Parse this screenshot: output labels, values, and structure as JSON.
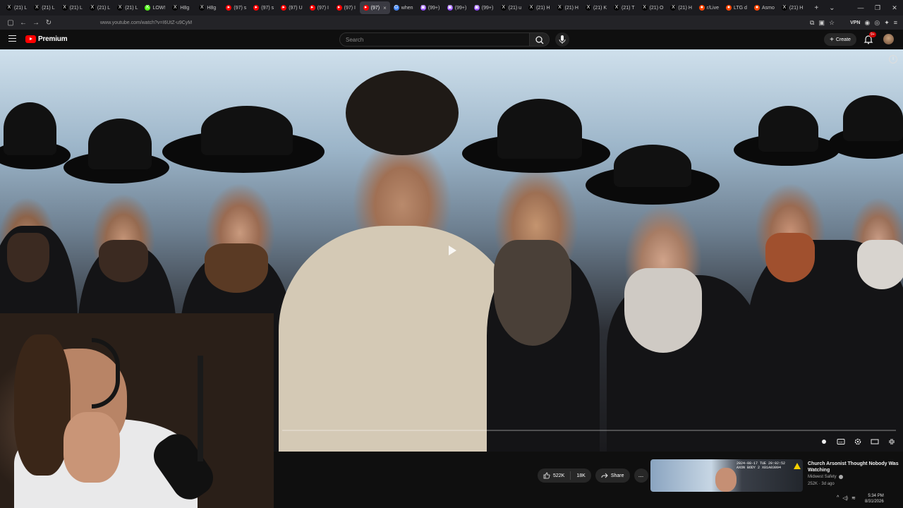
{
  "browser": {
    "tabs": [
      {
        "label": "(21) L",
        "icon": "x-icon"
      },
      {
        "label": "(21) L",
        "icon": "x-icon"
      },
      {
        "label": "(21) L",
        "icon": "x-icon"
      },
      {
        "label": "(21) L",
        "icon": "x-icon"
      },
      {
        "label": "(21) L",
        "icon": "x-icon"
      },
      {
        "label": "LOW!",
        "icon": "kick-icon"
      },
      {
        "label": "H8g",
        "icon": "x-icon"
      },
      {
        "label": "H8g",
        "icon": "x-icon"
      },
      {
        "label": "(97) s",
        "icon": "youtube-icon"
      },
      {
        "label": "(97) s",
        "icon": "youtube-icon"
      },
      {
        "label": "(97) U",
        "icon": "youtube-icon"
      },
      {
        "label": "(97) I",
        "icon": "youtube-icon"
      },
      {
        "label": "(97) I",
        "icon": "youtube-icon"
      },
      {
        "label": "(97)",
        "icon": "youtube-icon",
        "active": true
      },
      {
        "label": "when",
        "icon": "google-icon"
      },
      {
        "label": "(99+)",
        "icon": "twitch-icon"
      },
      {
        "label": "(99+)",
        "icon": "twitch-icon"
      },
      {
        "label": "(99+)",
        "icon": "twitch-icon"
      },
      {
        "label": "(21) u",
        "icon": "x-icon"
      },
      {
        "label": "(21) H",
        "icon": "x-icon"
      },
      {
        "label": "(21) H",
        "icon": "x-icon"
      },
      {
        "label": "(21) K",
        "icon": "x-icon"
      },
      {
        "label": "(21) T",
        "icon": "x-icon"
      },
      {
        "label": "(21) O",
        "icon": "x-icon"
      },
      {
        "label": "(21) H",
        "icon": "x-icon"
      },
      {
        "label": "r/Live",
        "icon": "reddit-icon"
      },
      {
        "label": "LTG d",
        "icon": "reddit-icon"
      },
      {
        "label": "Asmo",
        "icon": "reddit-icon"
      },
      {
        "label": "(21) H",
        "icon": "x-icon"
      }
    ],
    "url": "www.youtube.com/watch?v=I6UtZ-u9CyM",
    "vpn_label": "VPN"
  },
  "youtube": {
    "logo_text": "Premium",
    "search_placeholder": "Search",
    "create_label": "Create",
    "notification_count": "9+"
  },
  "video": {
    "progress_fraction": 0.0,
    "actions": {
      "likes": "522K",
      "dislikes": "18K",
      "share": "Share",
      "more": "..."
    }
  },
  "recommendation": {
    "title": "Church Arsonist Thought Nobody Was Watching",
    "channel": "Midwest Safety",
    "views": "252K",
    "age": "3d ago",
    "overlay_stamp": "2024-08-17 TUE 20:02:52\nAXON BODY 2 X81A03094"
  },
  "system_tray": {
    "time": "5:34 PM",
    "date": "8/31/2026"
  },
  "colors": {
    "brand_red": "#ff0000",
    "background": "#0f0f0f",
    "pill": "#272727"
  }
}
